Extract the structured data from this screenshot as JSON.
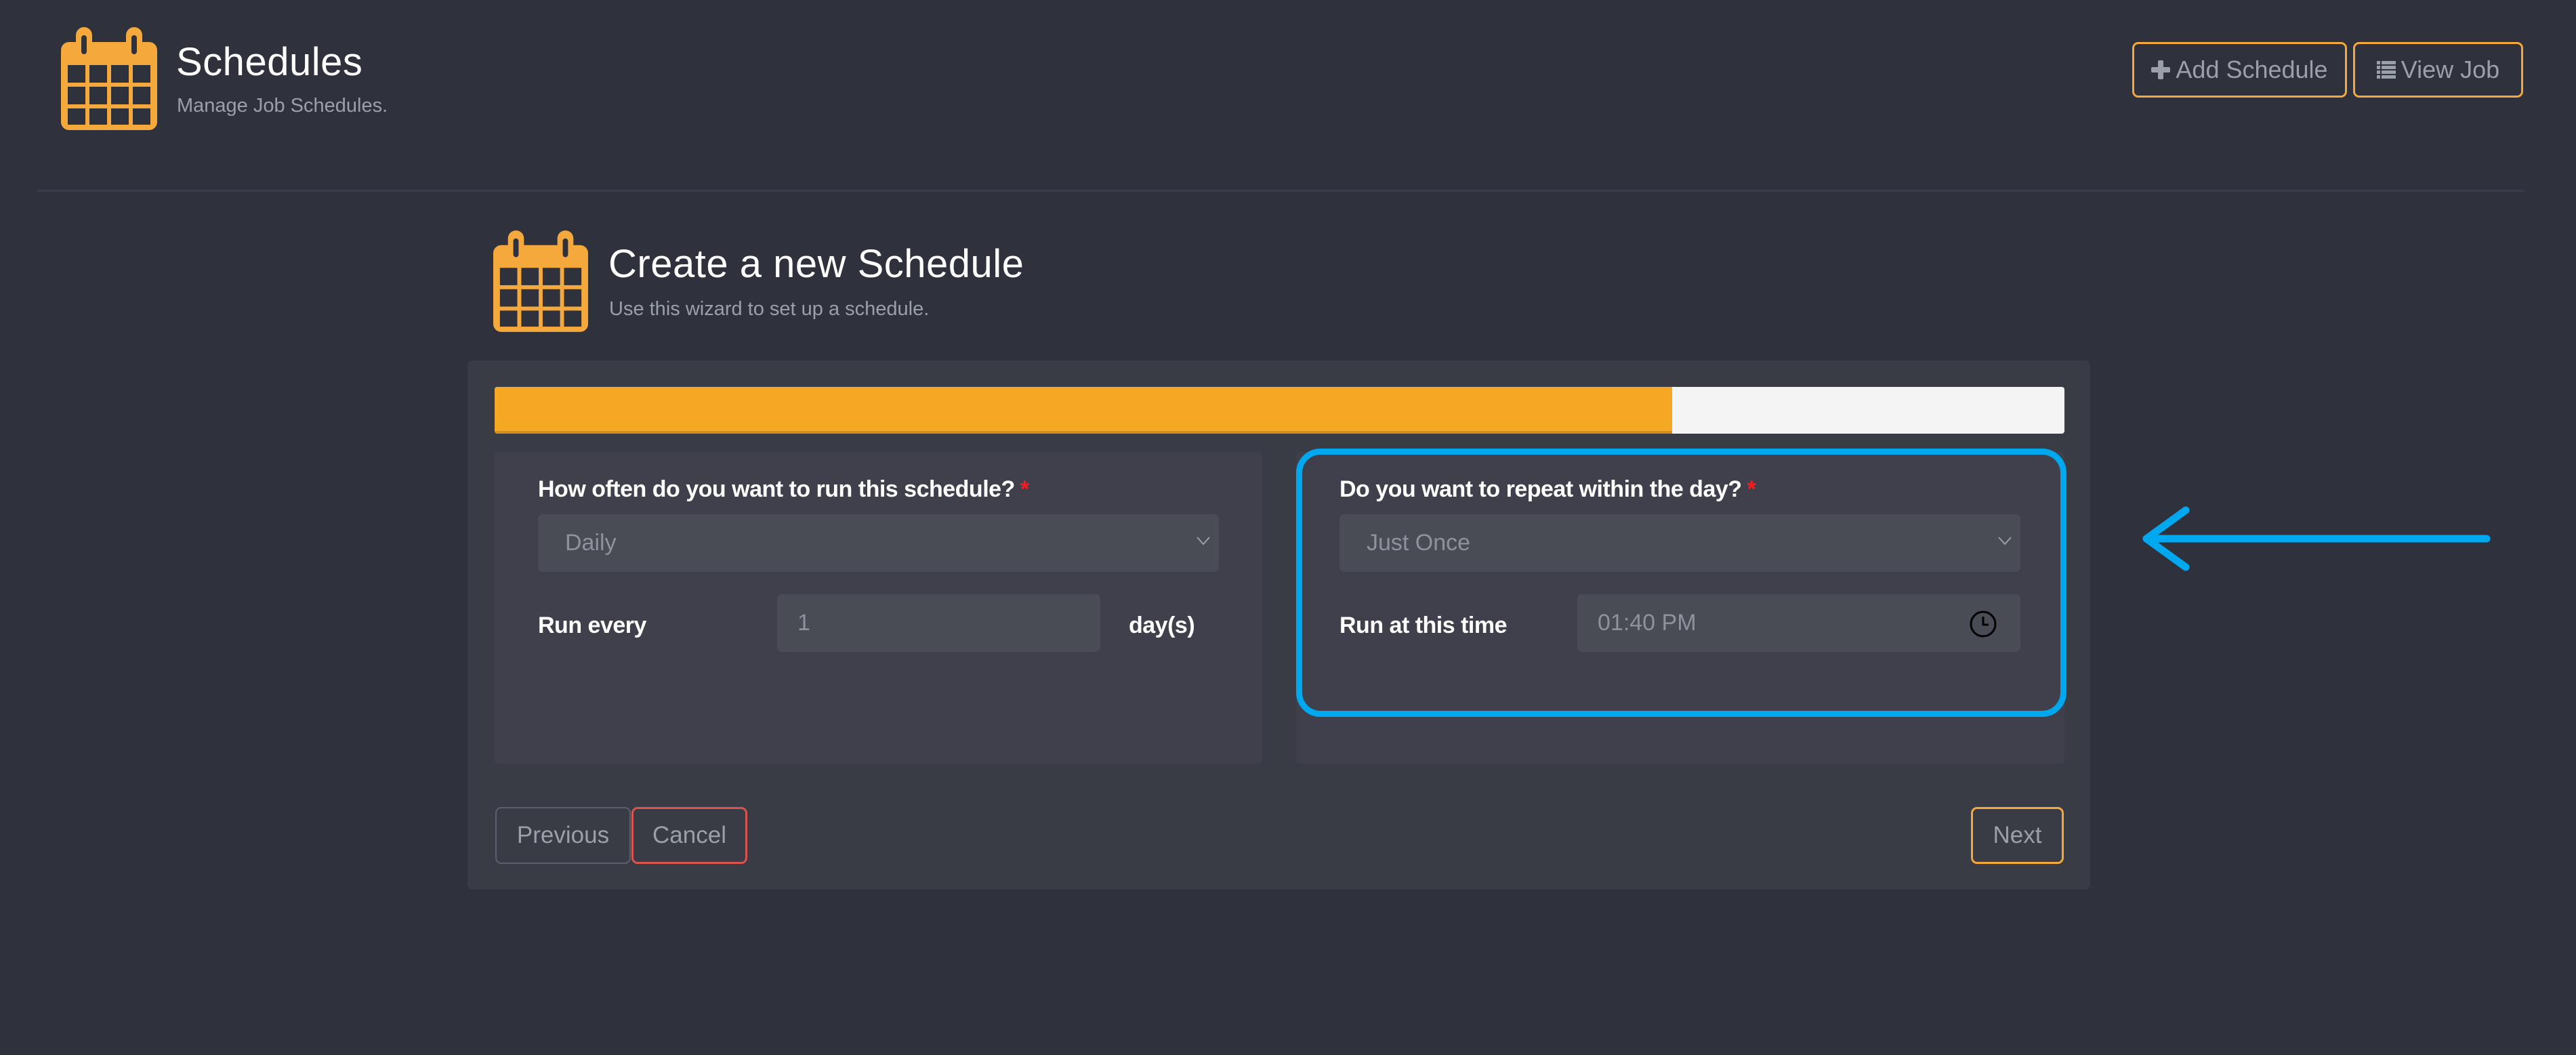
{
  "header": {
    "icon": "calendar-icon",
    "title": "Schedules",
    "subtitle": "Manage Job Schedules.",
    "buttons": [
      {
        "label": "Add Schedule",
        "icon": "plus-icon"
      },
      {
        "label": "View Job",
        "icon": "list-icon"
      }
    ]
  },
  "wizard": {
    "icon": "calendar-icon",
    "title": "Create a new Schedule",
    "subtitle": "Use this wizard to set up a schedule.",
    "progress_percent": 75,
    "left_panel": {
      "frequency_label": "How often do you want to run this schedule?",
      "frequency_required": "*",
      "frequency_value": "Daily",
      "run_every_label": "Run every",
      "run_every_value": "1",
      "run_every_unit": "day(s)"
    },
    "right_panel": {
      "repeat_label": "Do you want to repeat within the day?",
      "repeat_required": "*",
      "repeat_value": "Just Once",
      "time_label": "Run at this time",
      "time_value": "01:40 PM",
      "time_icon": "clock-icon"
    },
    "footer": {
      "previous_label": "Previous",
      "cancel_label": "Cancel",
      "next_label": "Next"
    }
  },
  "annotation": {
    "highlight_color": "#00a8f0",
    "arrow": "arrow-left-icon"
  },
  "colors": {
    "accent": "#f5a83c",
    "progress": "#f5a823",
    "danger": "#d9534f",
    "background": "#2f323c"
  }
}
